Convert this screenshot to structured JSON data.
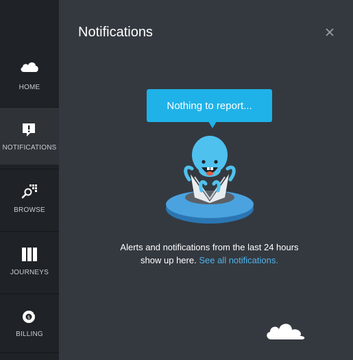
{
  "sidebar": {
    "items": [
      {
        "label": "HOME",
        "icon": "cloud-icon"
      },
      {
        "label": "NOTIFICATIONS",
        "icon": "alert-speech-icon"
      },
      {
        "label": "BROWSE",
        "icon": "browse-search-icon"
      },
      {
        "label": "JOURNEYS",
        "icon": "columns-icon"
      },
      {
        "label": "BILLING",
        "icon": "billing-coin-icon"
      }
    ],
    "active": "NOTIFICATIONS"
  },
  "panel": {
    "title": "Notifications",
    "close_icon": "close-icon",
    "bubble_text": "Nothing to report...",
    "message_text": "Alerts and notifications from the last 24 hours show up here.",
    "message_link": "See all notifications."
  },
  "colors": {
    "sidebar_bg": "#1f2226",
    "panel_bg": "#343940",
    "accent": "#1fb2e8",
    "link": "#4fb3e8"
  }
}
